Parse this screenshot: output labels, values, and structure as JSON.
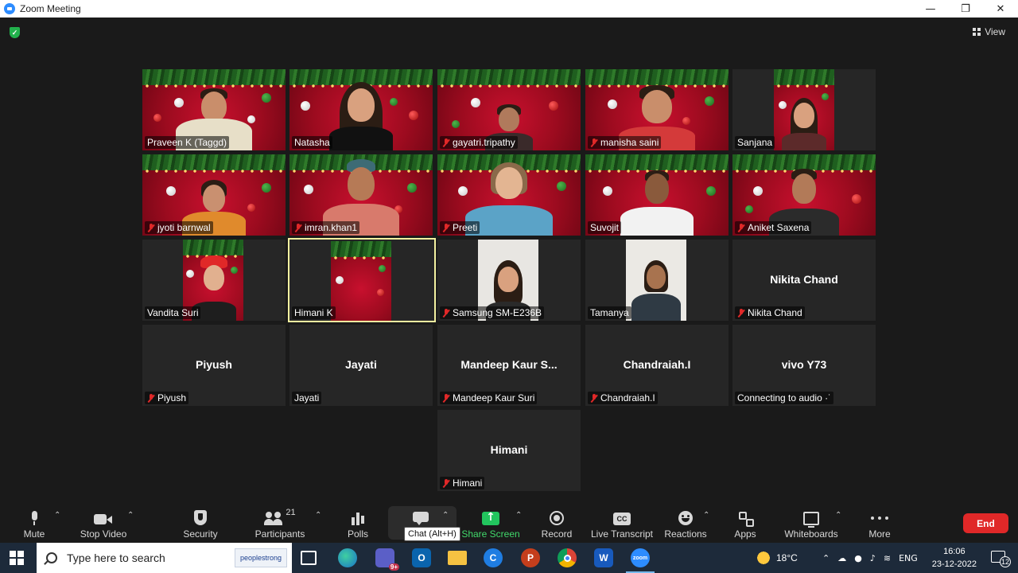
{
  "window": {
    "title": "Zoom Meeting",
    "minimize": "—",
    "restore": "❐",
    "close": "✕"
  },
  "meeting": {
    "view_label": "View",
    "participants": [
      {
        "name": "Praveen K (Taggd)",
        "muted": false
      },
      {
        "name": "Natasha",
        "muted": false
      },
      {
        "name": "gayatri.tripathy",
        "muted": true
      },
      {
        "name": "manisha saini",
        "muted": true
      },
      {
        "name": "Sanjana",
        "muted": false
      },
      {
        "name": "jyoti barnwal",
        "muted": true
      },
      {
        "name": "imran.khan1",
        "muted": true
      },
      {
        "name": "Preeti",
        "muted": true
      },
      {
        "name": "Suvojit",
        "muted": false
      },
      {
        "name": "Aniket Saxena",
        "muted": true
      },
      {
        "name": "Vandita Suri",
        "muted": false
      },
      {
        "name": "Himani K",
        "muted": false,
        "active_speaker": true
      },
      {
        "name": "Samsung SM-E236B",
        "muted": true
      },
      {
        "name": "Tamanya",
        "muted": false
      },
      {
        "name": "Nikita Chand",
        "display": "Nikita Chand",
        "muted": true
      },
      {
        "name": "Piyush",
        "display": "Piyush",
        "muted": true
      },
      {
        "name": "Jayati",
        "display": "Jayati",
        "muted": false
      },
      {
        "name": "Mandeep Kaur Suri",
        "display": "Mandeep Kaur S...",
        "muted": true
      },
      {
        "name": "Chandraiah.I",
        "display": "Chandraiah.I",
        "muted": true
      },
      {
        "name": "Connecting to audio ·˙",
        "display": "vivo Y73",
        "muted": false
      },
      {
        "name": "Himani",
        "display": "Himani",
        "muted": true
      }
    ]
  },
  "toolbar": {
    "mute": "Mute",
    "stop_video": "Stop Video",
    "security": "Security",
    "participants": "Participants",
    "participants_count": "21",
    "polls": "Polls",
    "chat_tooltip": "Chat (Alt+H)",
    "share_screen": "Share Screen",
    "record": "Record",
    "live_transcript": "Live Transcript",
    "cc_badge": "CC",
    "reactions": "Reactions",
    "apps": "Apps",
    "whiteboards": "Whiteboards",
    "more": "More",
    "end": "End"
  },
  "taskbar": {
    "search_placeholder": "Type here to search",
    "search_brand": "peoplestrong",
    "teams_badge": "9+",
    "temperature": "18°C",
    "language": "ENG",
    "time": "16:06",
    "date": "23-12-2022",
    "notifications": "12"
  },
  "colors": {
    "accent_green": "#41d86b",
    "end_red": "#e02828",
    "active_border": "#f3f1a0"
  }
}
